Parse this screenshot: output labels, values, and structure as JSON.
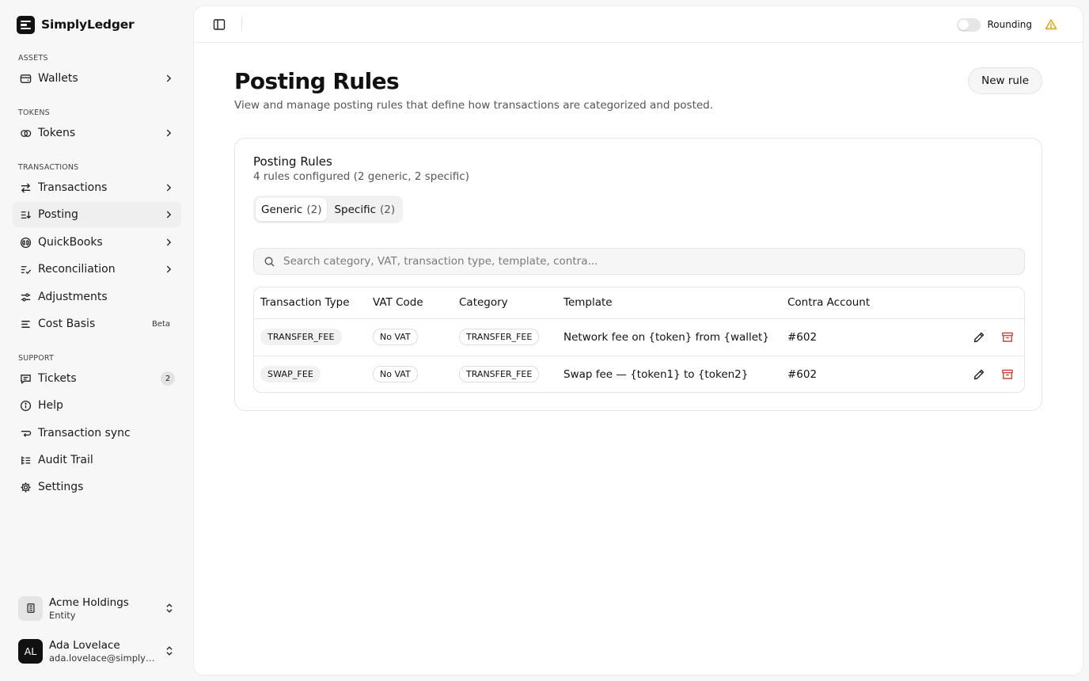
{
  "brand": {
    "name": "SimplyLedger"
  },
  "sidebar": {
    "sections": {
      "assets": "ASSETS",
      "tokens": "TOKENS",
      "transactions": "TRANSACTIONS",
      "support": "SUPPORT"
    },
    "items": {
      "wallets": "Wallets",
      "tokens": "Tokens",
      "transactions": "Transactions",
      "posting": "Posting",
      "quickbooks": "QuickBooks",
      "reconciliation": "Reconciliation",
      "adjustments": "Adjustments",
      "cost_basis": "Cost Basis",
      "cost_basis_badge": "Beta",
      "tickets": "Tickets",
      "tickets_count": "2",
      "help": "Help",
      "transaction_sync": "Transaction sync",
      "audit_trail": "Audit Trail",
      "settings": "Settings"
    },
    "active": "posting",
    "entity": {
      "name": "Acme Holdings",
      "type": "Entity"
    },
    "user": {
      "initials": "AL",
      "name": "Ada Lovelace",
      "email": "ada.lovelace@simplyled..."
    }
  },
  "topbar": {
    "rounding_label": "Rounding",
    "rounding_on": false,
    "warning_color": "#e0a100"
  },
  "page": {
    "title": "Posting Rules",
    "subtitle": "View and manage posting rules that define how transactions are categorized and posted.",
    "new_rule_label": "New rule"
  },
  "card": {
    "title": "Posting Rules",
    "subtitle": "4 rules configured (2 generic, 2 specific)",
    "tabs": [
      {
        "label": "Generic",
        "count": "(2)",
        "active": true
      },
      {
        "label": "Specific",
        "count": "(2)",
        "active": false
      }
    ],
    "search_placeholder": "Search category, VAT, transaction type, template, contra...",
    "table": {
      "headers": [
        "Transaction Type",
        "VAT Code",
        "Category",
        "Template",
        "Contra Account"
      ],
      "rows": [
        {
          "transaction_type": "TRANSFER_FEE",
          "vat_code": "No VAT",
          "category": "TRANSFER_FEE",
          "template": "Network fee on {token} from {wallet}",
          "contra_account": "#602"
        },
        {
          "transaction_type": "SWAP_FEE",
          "vat_code": "No VAT",
          "category": "TRANSFER_FEE",
          "template": "Swap fee — {token1} to {token2}",
          "contra_account": "#602"
        }
      ],
      "delete_color": "#d0453a"
    }
  }
}
